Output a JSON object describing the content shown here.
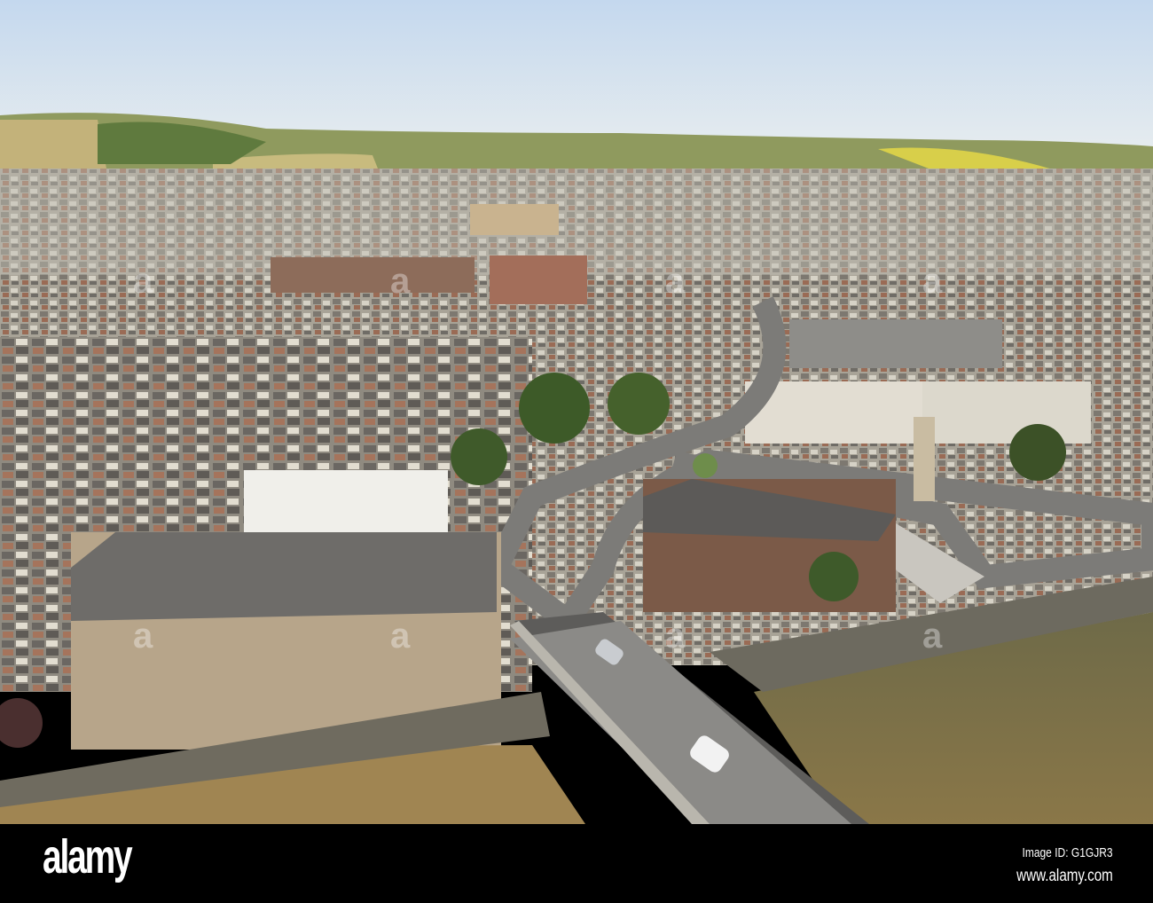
{
  "watermark": {
    "logo_text": "alamy",
    "image_id": "Image ID: G1GJR3",
    "website": "www.alamy.com"
  }
}
